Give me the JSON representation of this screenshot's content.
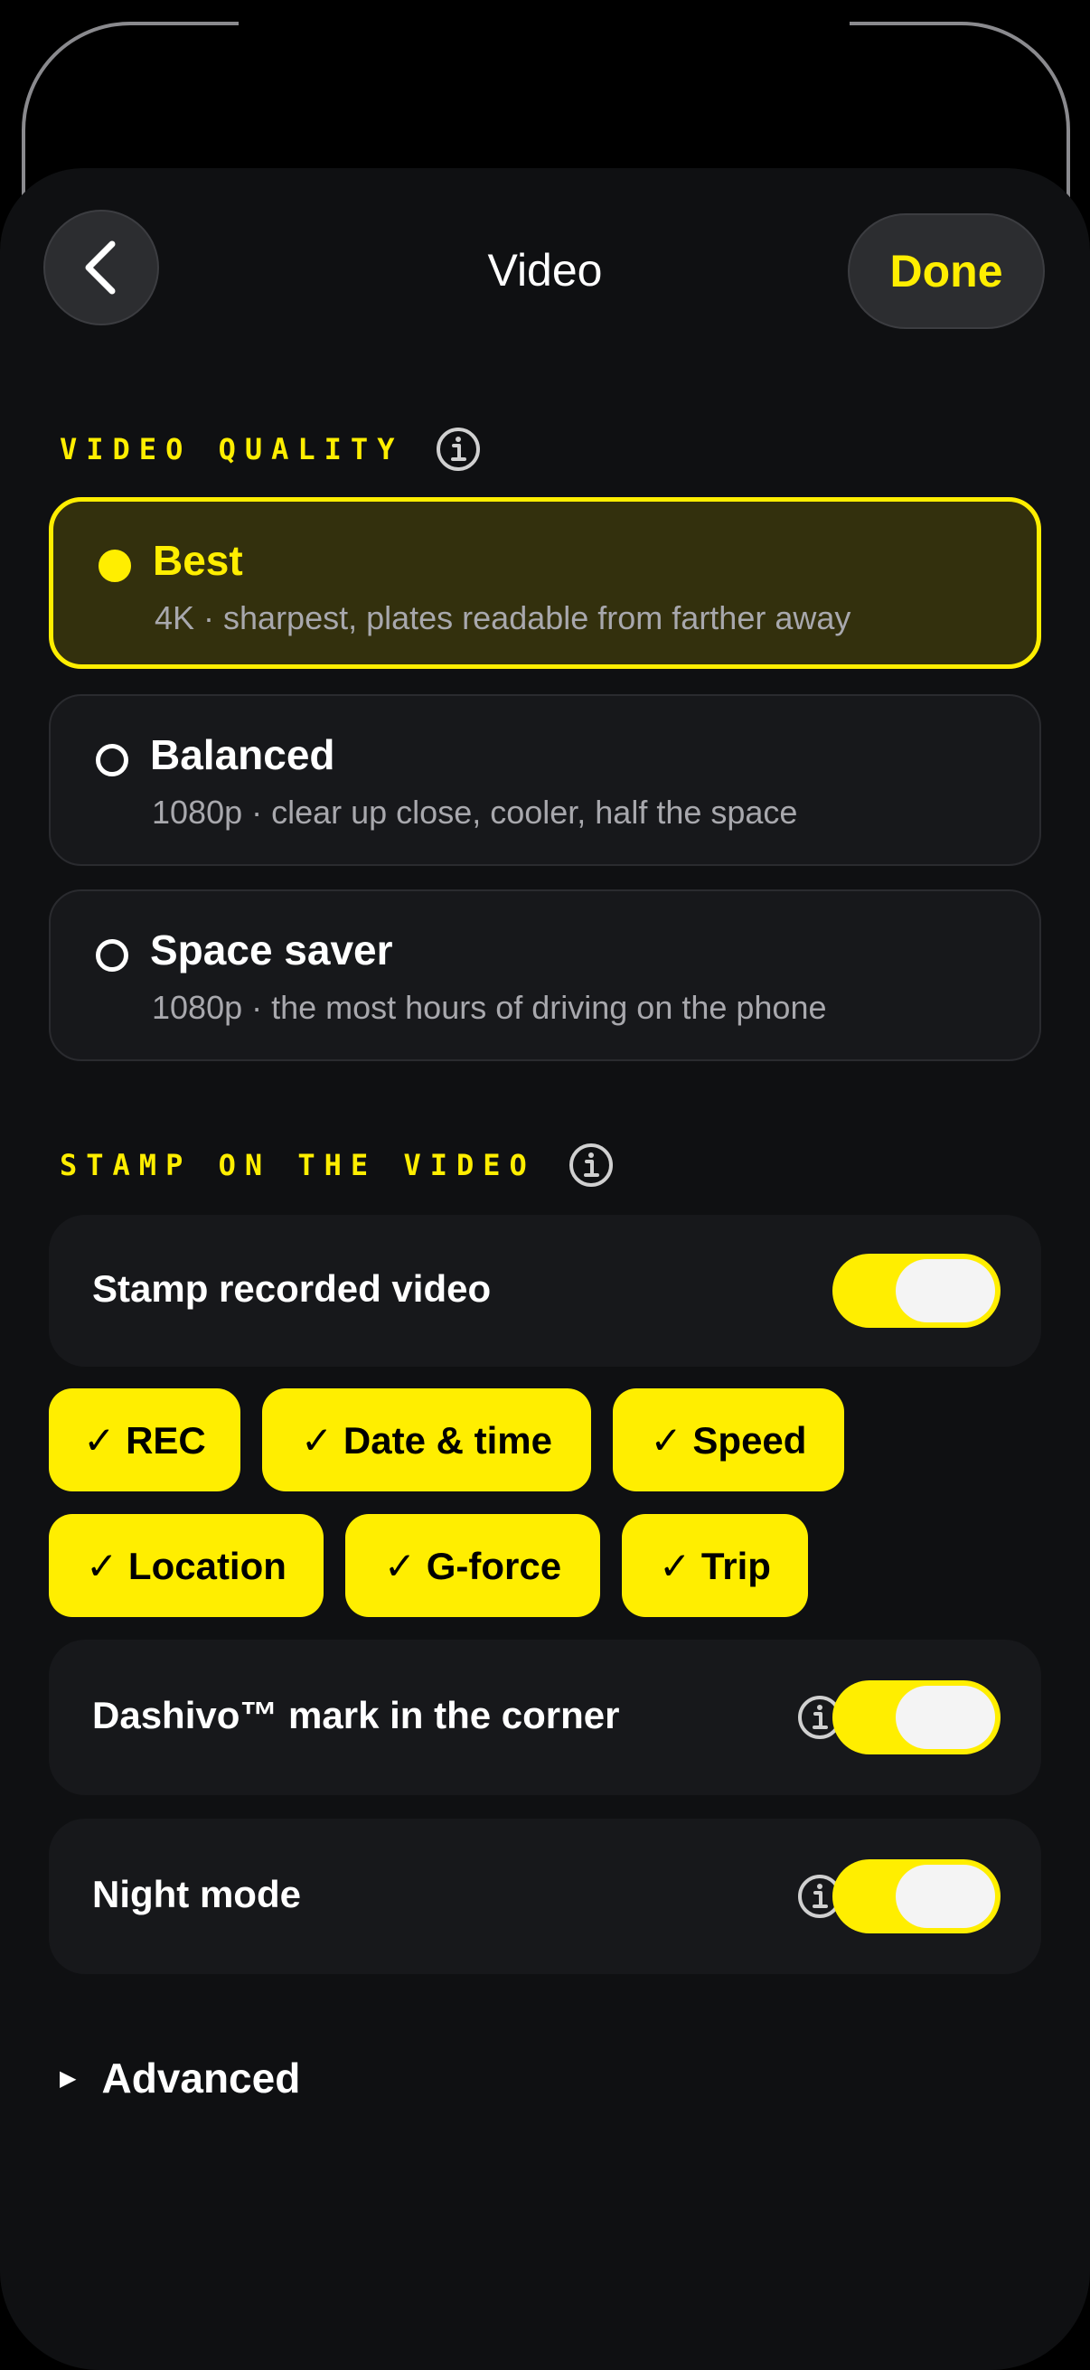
{
  "header": {
    "title": "Video",
    "done_label": "Done",
    "back_icon": "chevron-left-icon"
  },
  "video_quality": {
    "label": "VIDEO QUALITY",
    "options": [
      {
        "title": "Best",
        "desc": "4K · sharpest, plates readable from farther away",
        "selected": true
      },
      {
        "title": "Balanced",
        "desc": "1080p · clear up close, cooler, half the space",
        "selected": false
      },
      {
        "title": "Space saver",
        "desc": "1080p · the most hours of driving on the phone",
        "selected": false
      }
    ]
  },
  "stamp": {
    "label": "STAMP ON THE VIDEO",
    "stamp_recorded": {
      "label": "Stamp recorded video",
      "on": true
    },
    "chips": [
      "✓ REC",
      "✓ Date & time",
      "✓ Speed",
      "✓ Location",
      "✓ G-force",
      "✓ Trip"
    ],
    "mark": {
      "label": "Dashivo™ mark in the corner",
      "on": true
    },
    "night": {
      "label": "Night mode",
      "on": true
    }
  },
  "advanced": {
    "label": "Advanced"
  },
  "colors": {
    "accent": "#ffee00",
    "background": "#0f1012",
    "card": "#17181b",
    "selected_bg": "#33300d"
  }
}
